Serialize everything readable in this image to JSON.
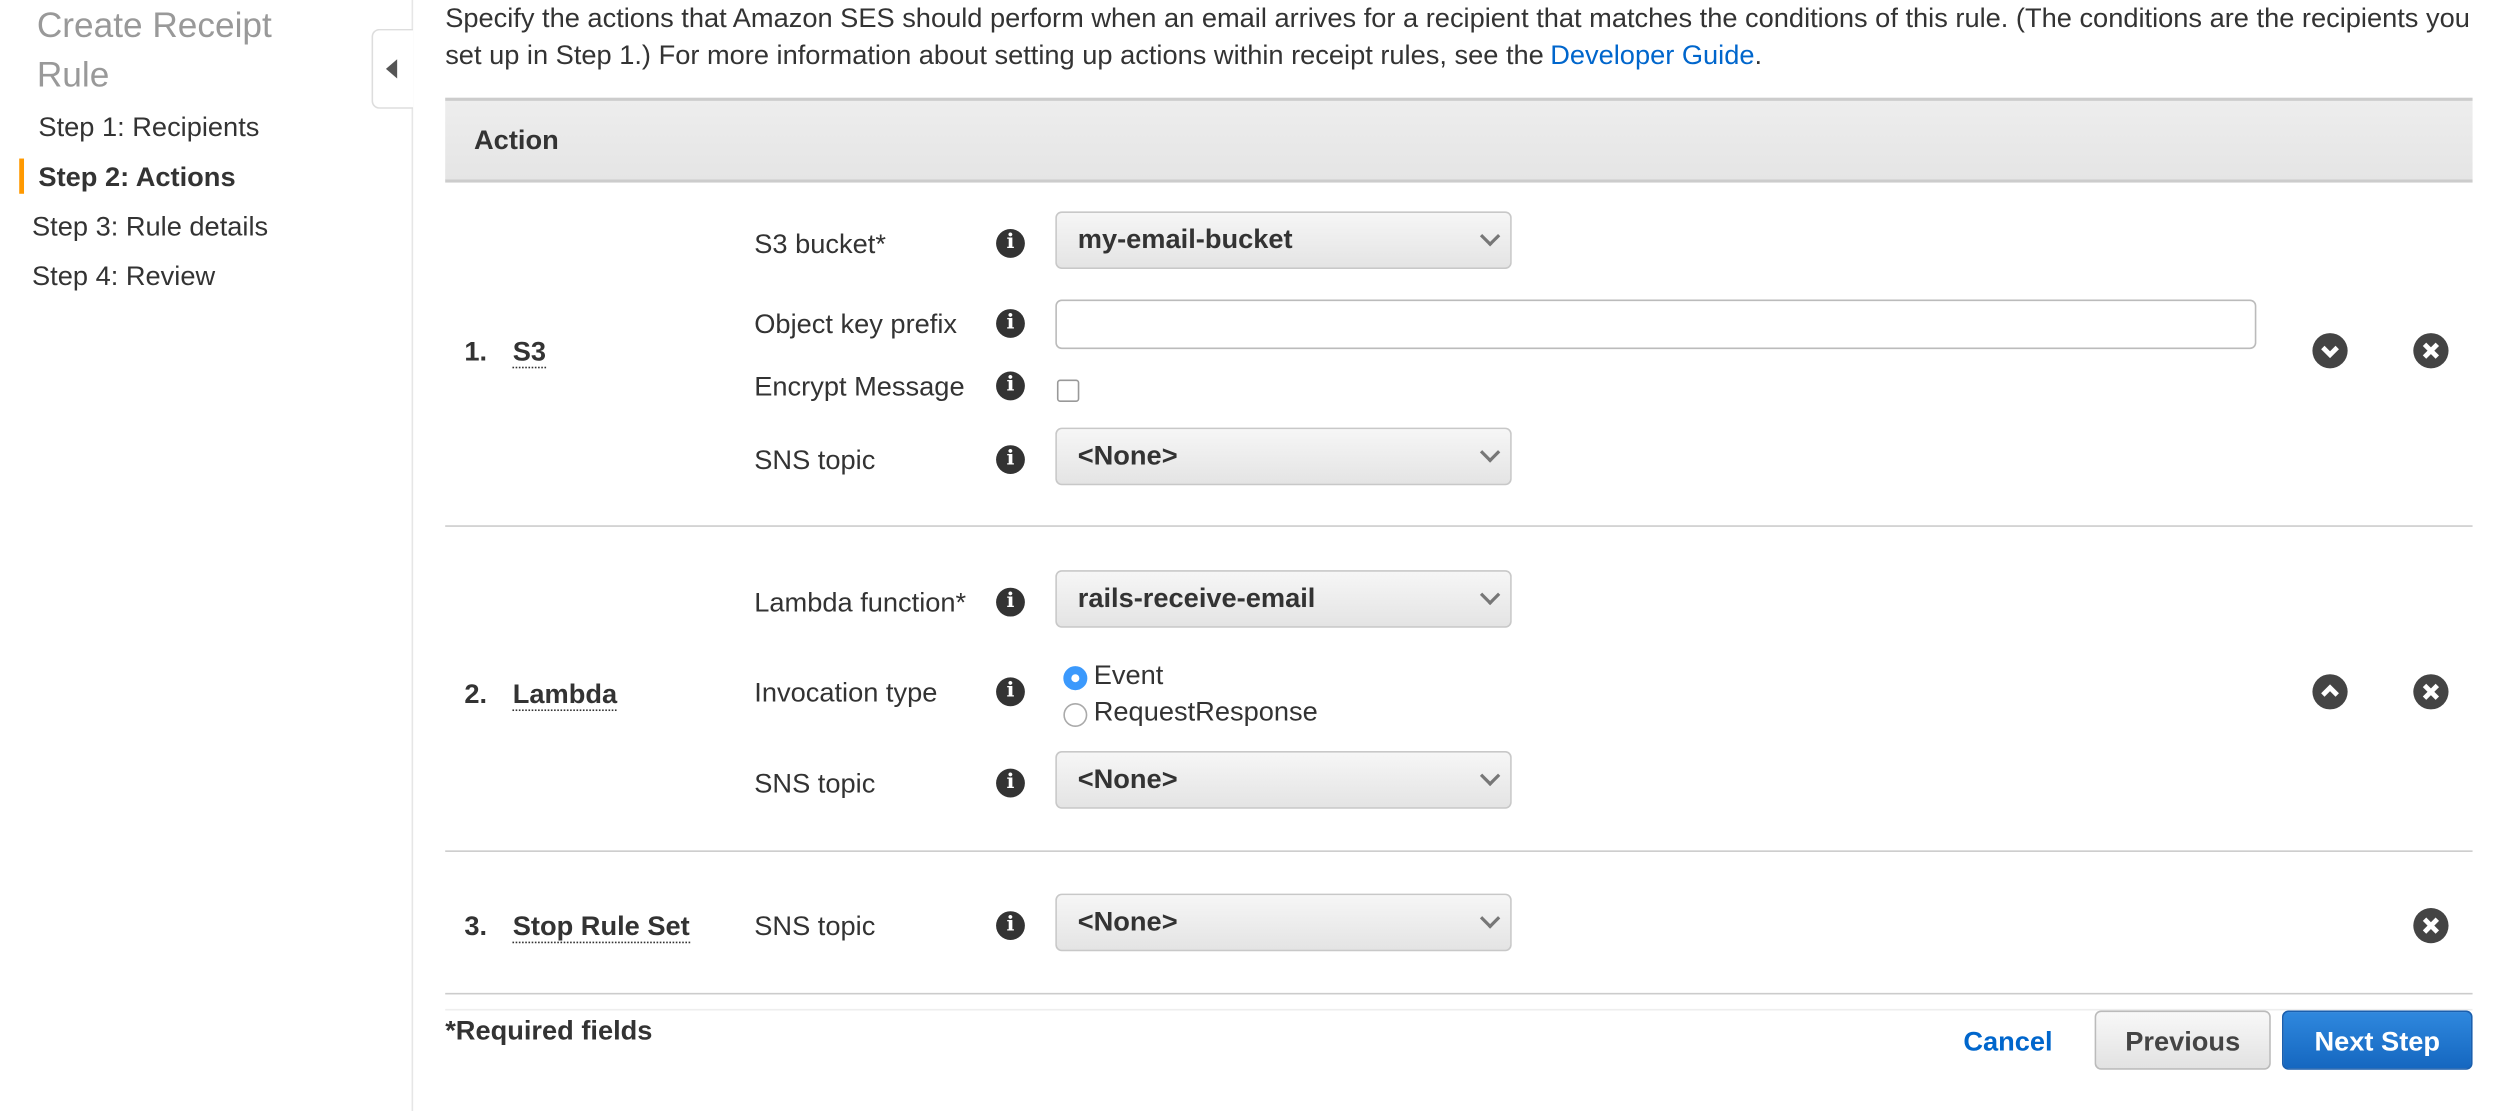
{
  "sidebar": {
    "title": "Create Receipt Rule",
    "steps": [
      {
        "label": "Step 1: Recipients"
      },
      {
        "label": "Step 2: Actions",
        "active": true
      },
      {
        "label": "Step 3: Rule details"
      },
      {
        "label": "Step 4: Review"
      }
    ]
  },
  "intro": {
    "text": "Specify the actions that Amazon SES should perform when an email arrives for a recipient that matches the conditions of this rule. (The conditions are the recipients you set up in Step 1.) For more information about setting up actions within receipt rules, see the",
    "link": "Developer Guide",
    "suffix": "."
  },
  "table": {
    "header": "Action"
  },
  "actions": [
    {
      "num": "1.",
      "name": "S3",
      "fields": {
        "bucket_label": "S3 bucket*",
        "bucket_value": "my-email-bucket",
        "prefix_label": "Object key prefix",
        "prefix_value": "",
        "encrypt_label": "Encrypt Message",
        "encrypt_checked": false,
        "sns_label": "SNS topic",
        "sns_value": "<None>"
      }
    },
    {
      "num": "2.",
      "name": "Lambda",
      "fields": {
        "function_label": "Lambda function*",
        "function_value": "rails-receive-email",
        "invocation_label": "Invocation type",
        "options": [
          "Event",
          "RequestResponse"
        ],
        "selected": "Event",
        "sns_label": "SNS topic",
        "sns_value": "<None>"
      }
    },
    {
      "num": "3.",
      "name": "Stop Rule Set",
      "fields": {
        "sns_label": "SNS topic",
        "sns_value": "<None>"
      }
    }
  ],
  "icons": {
    "info": "info-icon",
    "move_down": "chevron-down-circle-icon",
    "move_up": "chevron-up-circle-icon",
    "remove": "close-circle-icon",
    "collapse": "caret-left-icon"
  },
  "footer": {
    "required": "*Required fields",
    "cancel": "Cancel",
    "previous": "Previous",
    "next": "Next Step"
  },
  "colors": {
    "accent": "#ff9900",
    "link": "#0066cc",
    "primary": "#1f75d0"
  }
}
